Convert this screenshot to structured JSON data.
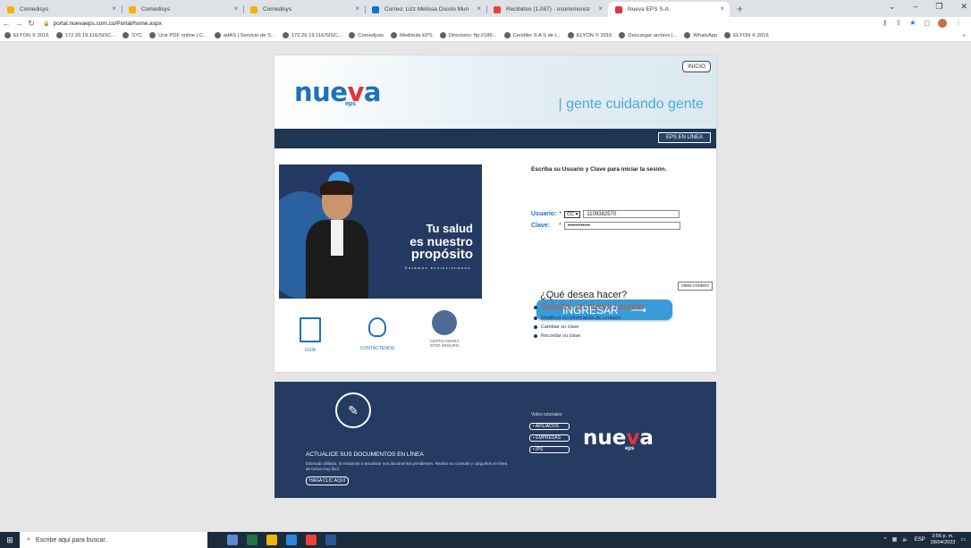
{
  "browser": {
    "tabs": [
      {
        "title": "Comedisys",
        "icon_color": "#f4b400",
        "active": false
      },
      {
        "title": "Comedisys",
        "icon_color": "#f4b400",
        "active": false
      },
      {
        "title": "Comedisys",
        "icon_color": "#f4b400",
        "active": false
      },
      {
        "title": "Correo: Lizz Melissa Osorio Mun",
        "icon_color": "#0078d4",
        "active": false
      },
      {
        "title": "Recibidos (1.087) - osoriomunoz",
        "icon_color": "#ea4335",
        "active": false
      },
      {
        "title": "Nueva EPS S.A",
        "icon_color": "#e3343b",
        "active": true
      }
    ],
    "new_tab": "+",
    "url": "portal.nuevaeps.com.co/Portal/home.aspx",
    "bookmarks": [
      "ELYON © 2016",
      "172.26.19.116/SISC...",
      "SYC",
      "Unir PDF online | C...",
      "adAS | Servicio de S...",
      "172.26.19.116/SISC...",
      "Comedysis",
      "Medimás EPS",
      "Directorio: ftp://186...",
      "Cendiler S A S de l...",
      "ELYON © 2016",
      "Descargar archivo |...",
      "WhatsApp",
      "ELYON © 2016"
    ],
    "bookmarks_more": "»"
  },
  "header": {
    "logo_main": "nue",
    "logo_v": "v",
    "logo_end": "a",
    "logo_sub": "eps",
    "inicio": "INICIO",
    "tagline": "| gente cuidando gente",
    "eps_en_linea": "EPS EN LÍNEA"
  },
  "banner": {
    "line1": "Tu salud",
    "line2": "es nuestro",
    "line3": "propósito",
    "line4": "Estamos evolucionando"
  },
  "icons": {
    "guia": "GUÍA",
    "contactenos": "CONTÁCTENOS",
    "certicamara": "CERTICAMARA",
    "certicamara_sub": "SITIO SEGURO"
  },
  "login": {
    "intro": "Escriba su Usuario y Clave para iniciar la sesión.",
    "usuario_label": "Usuario:",
    "doc_type": "CC",
    "usuario_value": "1109382570",
    "clave_label": "Clave:",
    "clave_value": "••••••••••••",
    "required": "*",
    "submit": "INGRESAR",
    "submit_arrow": "⟶",
    "tooltip": "view-content"
  },
  "options": {
    "question": "¿Qué desea hacer?",
    "items": [
      "Solicitar un nuevo usuario",
      "Modificar su información de contacto",
      "Cambiar su clave",
      "Recordar su clave"
    ]
  },
  "footer": {
    "title": "ACTUALICE SUS DOCUMENTOS EN LÍNEA",
    "text": "Estimado afiliado, lo invitamos a actualizar sus documentos pendientes. Realice su consulta y cárguelos en línea de forma muy fácil.",
    "button": "HAGA CLIC AQUÍ",
    "video_label": "Video tutoriales",
    "video_buttons": [
      "• AFILIADOS",
      "• EMPRESAS",
      "• IPS"
    ]
  },
  "taskbar": {
    "search_placeholder": "Escribe aquí para buscar.",
    "lang": "ESP",
    "time": "3:56 p. m.",
    "date": "28/04/2023"
  }
}
